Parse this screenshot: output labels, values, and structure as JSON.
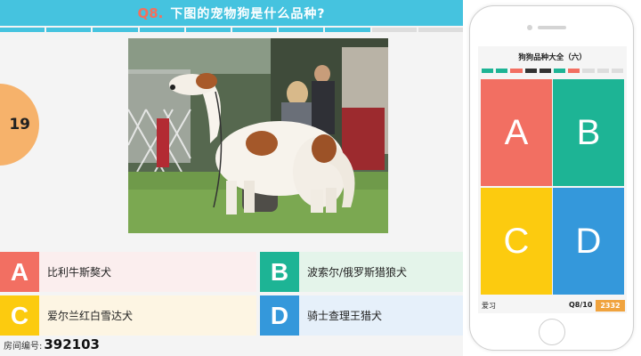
{
  "colors": {
    "header": "#45c3df",
    "question_number": "#f46f5c",
    "timer": "#f6b26b",
    "option_a": "#f26f62",
    "option_b": "#1db495",
    "option_c": "#fccb0f",
    "option_d": "#3498db",
    "room_badge": "#f0a33e"
  },
  "quiz": {
    "question_number": "Q8.",
    "question_text": "下图的宠物狗是什么品种?",
    "progress": [
      "#45c3df",
      "#45c3df",
      "#45c3df",
      "#45c3df",
      "#45c3df",
      "#45c3df",
      "#45c3df",
      "#45c3df",
      "#dddddd",
      "#dddddd"
    ],
    "timer": "19",
    "image": "dog-photo",
    "options": [
      {
        "letter": "A",
        "label": "比利牛斯獒犬"
      },
      {
        "letter": "B",
        "label": "波索尔/俄罗斯猎狼犬"
      },
      {
        "letter": "C",
        "label": "爱尔兰红白雪达犬"
      },
      {
        "letter": "D",
        "label": "骑士查理王猎犬"
      }
    ],
    "room_label": "房间编号:",
    "room_number": "392103"
  },
  "phone": {
    "title": "狗狗品种大全（六）",
    "progress": [
      "#1db495",
      "#1db495",
      "#f26f62",
      "#333333",
      "#333333",
      "#1db495",
      "#f26f62",
      "#dddddd",
      "#dddddd",
      "#dddddd"
    ],
    "tiles": [
      "A",
      "B",
      "C",
      "D"
    ],
    "username": "爱习",
    "question_count": "Q8/10",
    "room_code": "2332"
  }
}
